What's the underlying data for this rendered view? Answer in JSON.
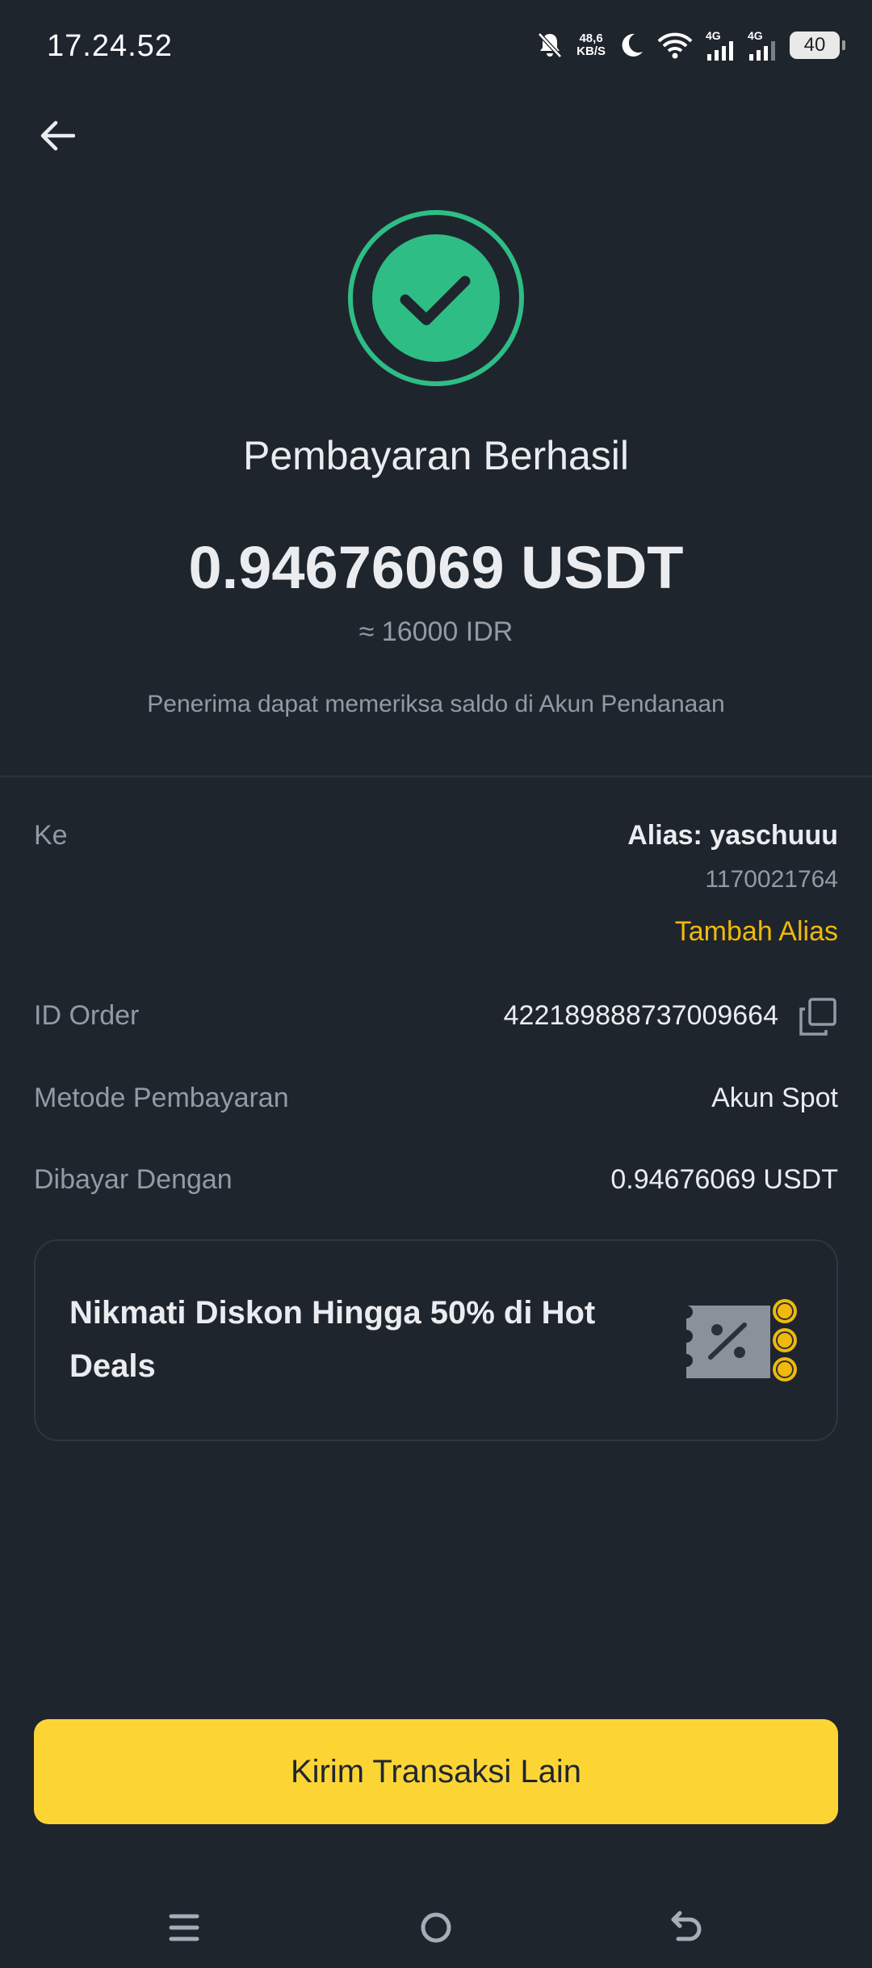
{
  "status_bar": {
    "time": "17.24.52",
    "net_speed_value": "48,6",
    "net_speed_unit": "KB/S",
    "sim1_label": "4G",
    "sim2_label": "4G",
    "battery": "40"
  },
  "header": {
    "back_icon": "arrow-left-icon"
  },
  "result": {
    "icon": "check-circle-icon",
    "title": "Pembayaran Berhasil",
    "amount": "0.94676069 USDT",
    "approx": "≈ 16000 IDR",
    "note": "Penerima dapat memeriksa saldo di Akun Pendanaan"
  },
  "details": {
    "to_label": "Ke",
    "alias": "Alias: yaschuuu",
    "account_no": "1170021764",
    "add_alias": "Tambah Alias",
    "order_label": "ID Order",
    "order_id": "422189888737009664",
    "method_label": "Metode Pembayaran",
    "method_value": "Akun Spot",
    "paid_label": "Dibayar Dengan",
    "paid_value": "0.94676069 USDT"
  },
  "promo": {
    "text": "Nikmati Diskon Hingga 50% di Hot Deals",
    "image": "discount-coupon-icon"
  },
  "cta": {
    "label": "Kirim Transaksi Lain"
  },
  "colors": {
    "background": "#1f252d",
    "success": "#2ebd85",
    "accent": "#f0b90b",
    "button": "#fcd535"
  }
}
